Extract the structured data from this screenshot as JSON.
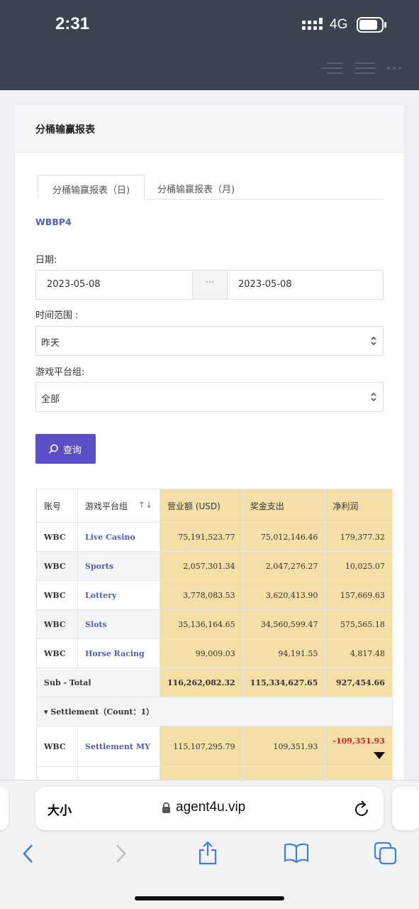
{
  "status_bar": {
    "time": "2:31",
    "network": "4G"
  },
  "card": {
    "title": "分桶输赢报表",
    "tabs": [
      {
        "label": "分桶输赢报表（日)"
      },
      {
        "label": "分桶输赢报表（月)"
      }
    ],
    "store_code": "WBBP4",
    "filters": {
      "date_label": "日期:",
      "date_from": "2023-05-08",
      "date_sep": "···",
      "date_to": "2023-05-08",
      "range_label": "时间范围 :",
      "range_value": "昨天",
      "group_label": "游戏平台组:",
      "group_value": "全部"
    },
    "query_button": "查询"
  },
  "table": {
    "headers": [
      "账号",
      "游戏平台组",
      "营业额 (USD)",
      "奖金支出",
      "净利润"
    ],
    "sort_glyph": "↑↓",
    "rows": [
      {
        "account": "WBC",
        "platform": "Live Casino",
        "turnover": "75,191,523.77",
        "payout": "75,012,146.46",
        "profit": "179,377.32"
      },
      {
        "account": "WBC",
        "platform": "Sports",
        "turnover": "2,057,301.34",
        "payout": "2,047,276.27",
        "profit": "10,025.07"
      },
      {
        "account": "WBC",
        "platform": "Lottery",
        "turnover": "3,778,083.53",
        "payout": "3,620,413.90",
        "profit": "157,669.63"
      },
      {
        "account": "WBC",
        "platform": "Slots",
        "turnover": "35,136,164.65",
        "payout": "34,560,599.47",
        "profit": "575,565.18"
      },
      {
        "account": "WBC",
        "platform": "Horse Racing",
        "turnover": "99,009.03",
        "payout": "94,191.55",
        "profit": "4,817.48"
      }
    ],
    "subtotal": {
      "label": "Sub - Total",
      "turnover": "116,262,082.32",
      "payout": "115,334,627.65",
      "profit": "927,454.66"
    },
    "group": {
      "label": "▾ Settlement（Count：1）"
    },
    "settlement_row": {
      "account": "WBC",
      "platform": "Settlement MY",
      "turnover": "115,107,295.79",
      "payout": "109,351.93",
      "profit": "-109,351.93"
    }
  },
  "browser": {
    "text_size": "大小",
    "url": "agent4u.vip"
  },
  "colors": {
    "accent": "#5b4fc7",
    "header_bg": "#3b4350",
    "highlight": "#f5dfa6",
    "link": "#4e5fc0",
    "negative": "#e02020"
  }
}
